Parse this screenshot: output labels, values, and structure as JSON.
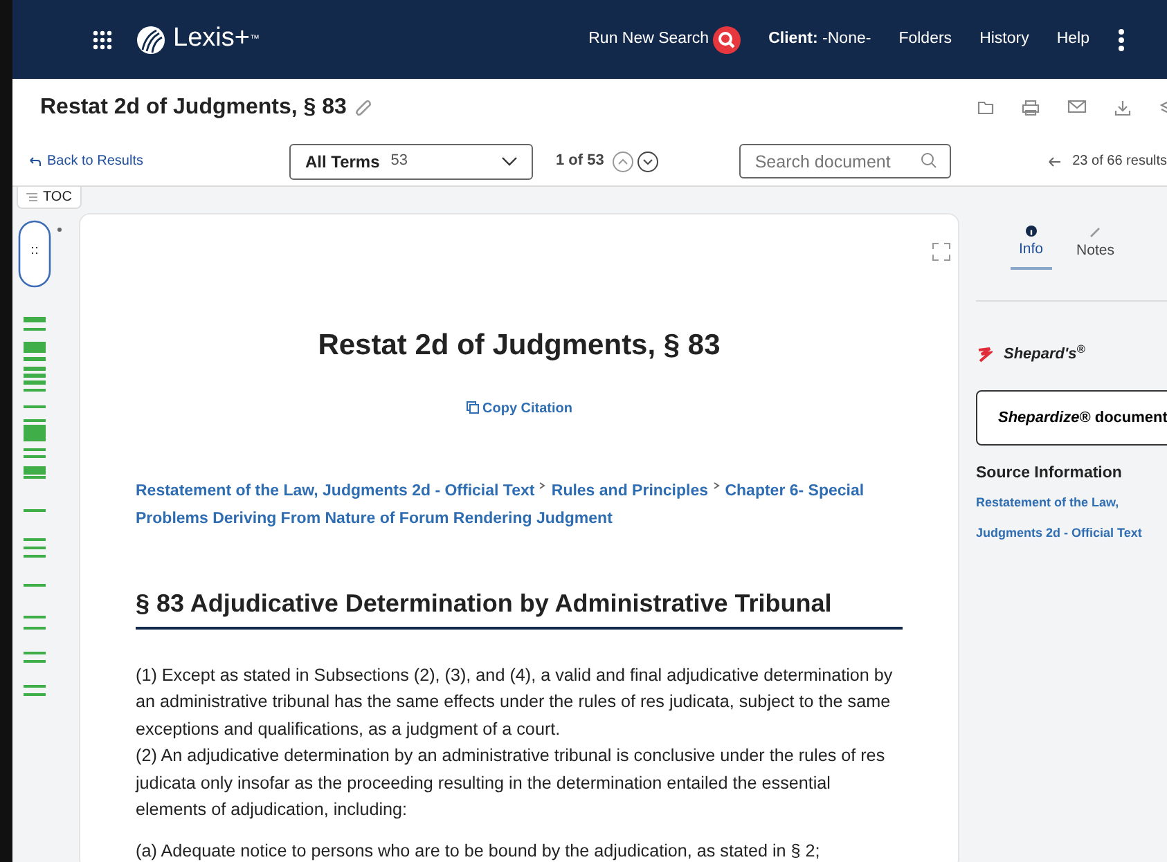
{
  "header": {
    "logo": "Lexis+",
    "logo_mark": "™",
    "links": [
      {
        "kind": "search",
        "label": "Run New Search"
      },
      {
        "kind": "client",
        "label": "Client:",
        "value": "-None-"
      },
      {
        "kind": "link",
        "label": "Folders"
      },
      {
        "kind": "link",
        "label": "History"
      },
      {
        "kind": "link",
        "label": "Help"
      }
    ]
  },
  "title": "Restat 2d of Judgments, § 83",
  "toolbar": {
    "back": "Back to Results",
    "terms": {
      "label": "All Terms",
      "count": "53"
    },
    "position": "1 of 53",
    "search": {
      "placeholder": "Search document"
    },
    "results": "23 of 66 results"
  },
  "toc": "TOC",
  "document": {
    "heading": "Restat 2d of Judgments, § 83",
    "copy_citation": "Copy Citation",
    "breadcrumbs": [
      "Restatement of the Law, Judgments 2d - Official Text",
      "Rules and Principles",
      "Chapter 6- Special Problems Deriving From Nature of Forum Rendering Judgment"
    ],
    "section_title": "§ 83 Adjudicative Determination by Administrative Tribunal",
    "paragraphs": [
      "(1)  Except as stated in Subsections (2), (3), and (4), a valid and final adjudicative determination by an administrative tribunal has the same effects under the rules of res judicata, subject to the same exceptions and qualifications, as a judgment of a court.",
      "(2)  An adjudicative determination by an administrative tribunal is conclusive under the rules of res judicata only insofar as the proceeding resulting in the determination entailed the essential elements of adjudication, including:",
      "(a)  Adequate notice to persons who are to be bound by the adjudication, as stated in § 2;"
    ]
  },
  "panel": {
    "tabs": [
      {
        "kind": "info",
        "label": "Info",
        "selected": true
      },
      {
        "kind": "notes",
        "label": "Notes",
        "selected": false
      }
    ],
    "shepards": "Shepard's$^{®}$",
    "shepardize": "*Shepardize*® document",
    "source_heading": "Source Information",
    "source_link": "Restatement of the Law, Judgments 2d - Official Text"
  }
}
